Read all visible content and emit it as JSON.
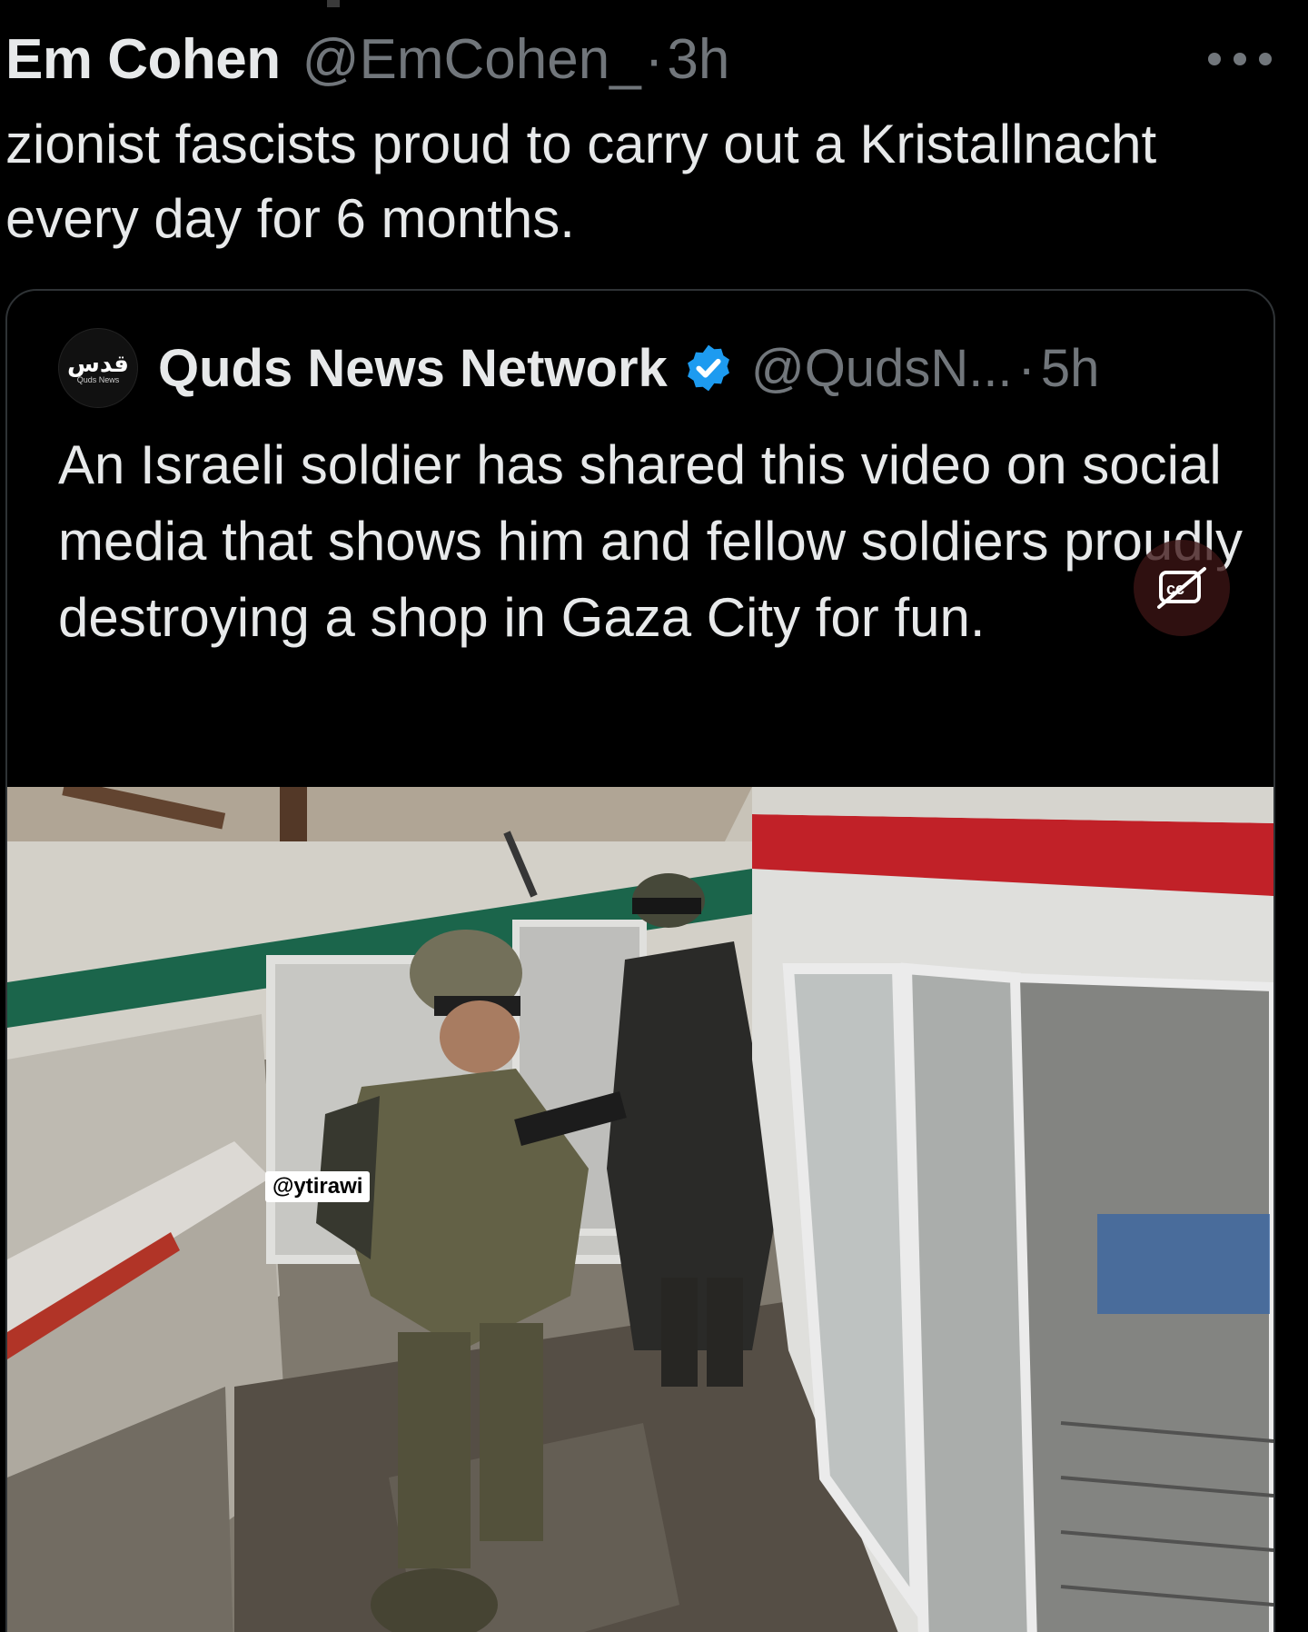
{
  "tweet": {
    "author_name": "Em Cohen",
    "author_handle": "@EmCohen_",
    "separator": "·",
    "time": "3h",
    "text": "zionist fascists proud to carry out a Kristallnacht every day for 6 months."
  },
  "quoted_tweet": {
    "avatar_glyph": "قدس",
    "avatar_subtext": "Quds News",
    "author_name": "Quds News Network",
    "author_handle": "@QudsN...",
    "separator": "·",
    "time": "5h",
    "text": "An Israeli soldier has shared this video on social media that shows him and fellow soldiers proudly destroying a shop in Gaza City for fun.",
    "media": {
      "watermark": "@ytirawi",
      "captions_icon": "captions-off-icon"
    }
  },
  "icons": {
    "more": "more-dots-icon",
    "verified": "verified-badge-icon"
  },
  "colors": {
    "background": "#000000",
    "text_primary": "#e7e9ea",
    "text_secondary": "#71767b",
    "verified_blue": "#1d9bf0",
    "card_border": "#2f3336"
  }
}
